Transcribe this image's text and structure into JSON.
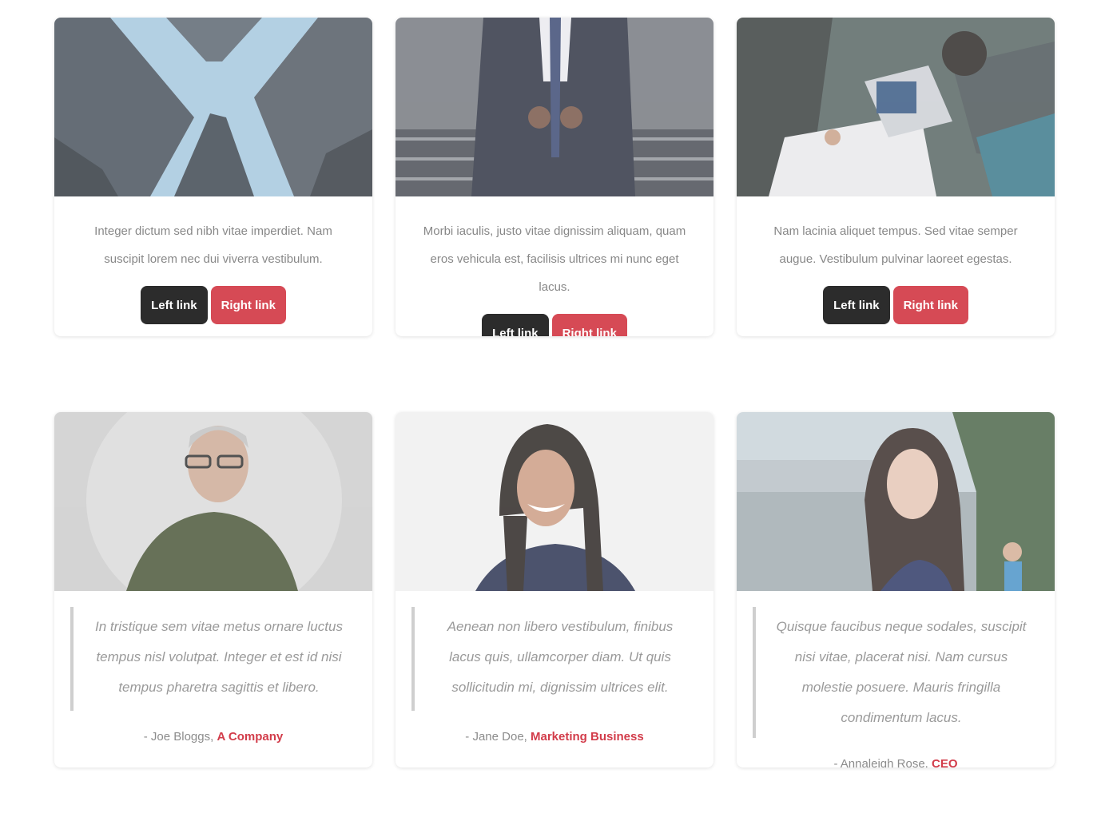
{
  "feature_cards": [
    {
      "image": "city-skyscrapers-looking-up",
      "text": "Integer dictum sed nibh vitae imperdiet. Nam suscipit lorem nec dui viverra vestibulum.",
      "left_link": "Left link",
      "right_link": "Right link"
    },
    {
      "image": "businessman-in-suit-on-stairs",
      "text": "Morbi iaculis, justo vitae dignissim aliquam, quam eros vehicula est, facilisis ultrices mi nunc eget lacus.",
      "left_link": "Left link",
      "right_link": "Right link"
    },
    {
      "image": "team-meeting-with-laptop-and-documents",
      "text": "Nam lacinia aliquet tempus. Sed vitae semper augue. Vestibulum pulvinar laoreet egestas.",
      "left_link": "Left link",
      "right_link": "Right link"
    }
  ],
  "testimonial_cards": [
    {
      "image": "older-man-with-glasses-portrait",
      "quote": "In tristique sem vitae metus ornare luctus tempus nisl volutpat. Integer et est id nisi tempus pharetra sagittis et libero.",
      "author": "- Joe Bloggs,",
      "company": "A Company"
    },
    {
      "image": "smiling-woman-portrait",
      "quote": "Aenean non libero vestibulum, finibus lacus quis, ullamcorper diam. Ut quis sollicitudin mi, dignissim ultrices elit.",
      "author": "- Jane Doe,",
      "company": "Marketing Business"
    },
    {
      "image": "woman-by-waterfront-portrait",
      "quote": "Quisque faucibus neque sodales, suscipit nisi vitae, placerat nisi. Nam cursus molestie posuere. Mauris fringilla condimentum lacus.",
      "author": "- Annaleigh Rose,",
      "company": "CEO"
    }
  ],
  "colors": {
    "dark_button": "#2c2c2c",
    "accent_red": "#d64a55",
    "link_red": "#d23c4a"
  }
}
